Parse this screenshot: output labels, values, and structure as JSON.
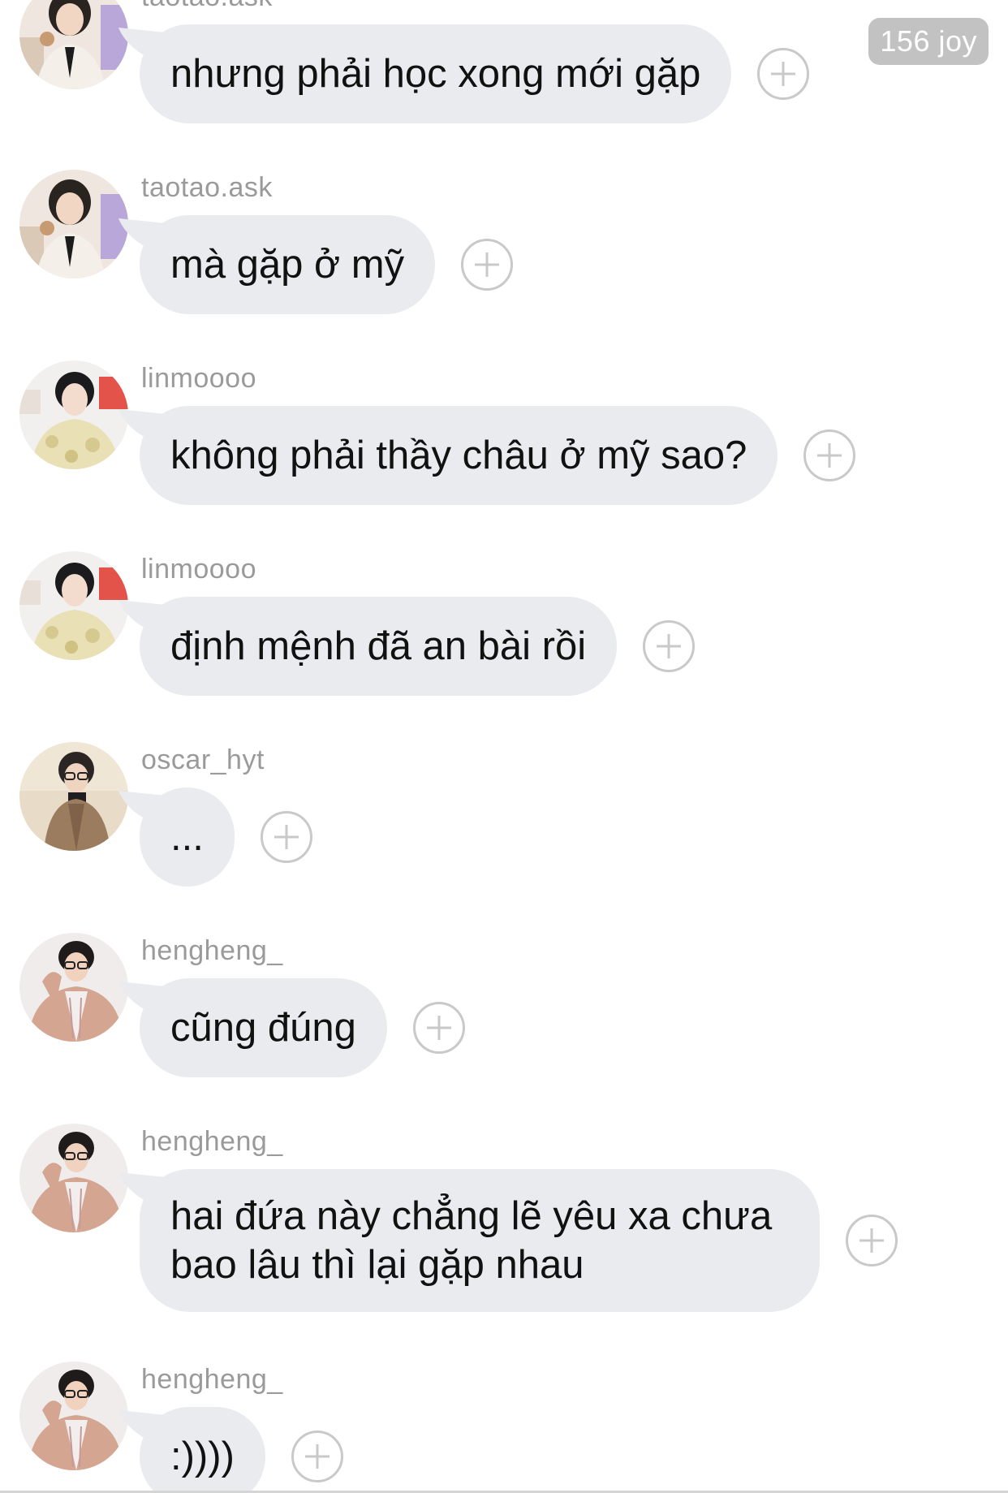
{
  "joy_badge": "156 joy",
  "messages": [
    {
      "username": "taotao.ask",
      "text": "nhưng phải học xong mới gặp",
      "avatar": "taotao-avatar"
    },
    {
      "username": "taotao.ask",
      "text": "mà gặp ở mỹ",
      "avatar": "taotao-avatar"
    },
    {
      "username": "linmoooo",
      "text": "không phải thầy châu ở mỹ sao?",
      "avatar": "linmoooo-avatar"
    },
    {
      "username": "linmoooo",
      "text": "định mệnh đã an bài rồi",
      "avatar": "linmoooo-avatar"
    },
    {
      "username": "oscar_hyt",
      "text": "...",
      "avatar": "oscar-avatar"
    },
    {
      "username": "hengheng_",
      "text": "cũng đúng",
      "avatar": "hengheng-avatar"
    },
    {
      "username": "hengheng_",
      "text": "hai đứa này chẳng lẽ yêu xa chưa bao lâu thì lại gặp nhau",
      "avatar": "hengheng-avatar"
    },
    {
      "username": "hengheng_",
      "text": ":))))",
      "avatar": "hengheng-avatar"
    }
  ],
  "colors": {
    "bubble": "#e9ebee",
    "username": "#9a9a9a",
    "badge": "#c2c2c2"
  }
}
